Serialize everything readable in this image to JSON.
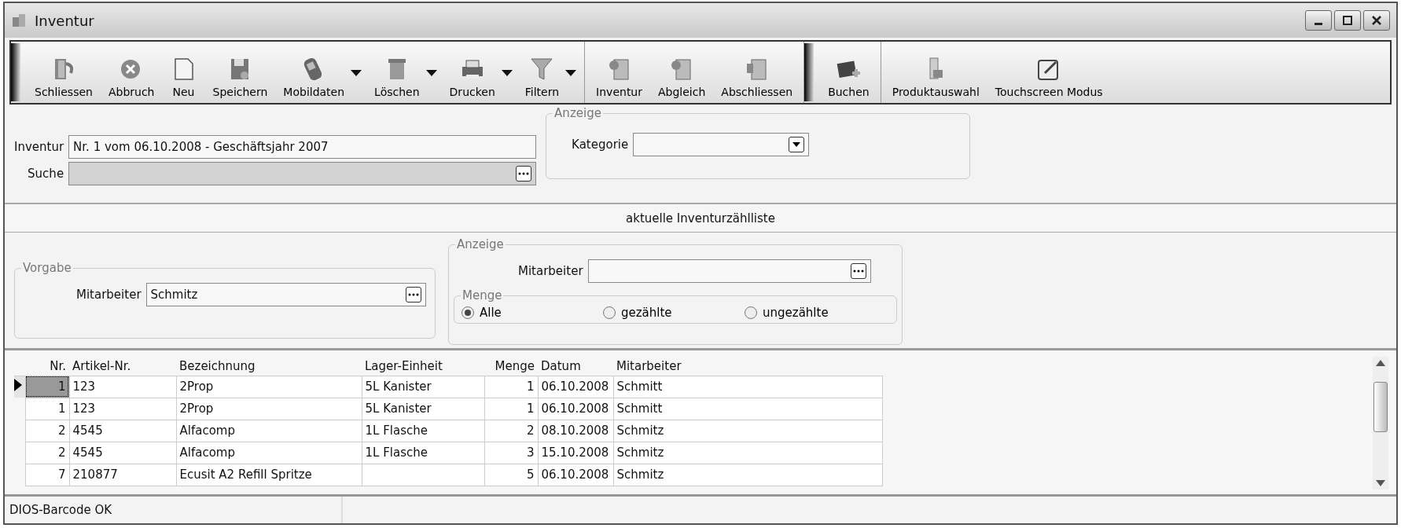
{
  "window": {
    "title": "Inventur"
  },
  "toolbar": {
    "groups": [
      [
        {
          "label": "Schliessen",
          "dropdown": false
        },
        {
          "label": "Abbruch",
          "dropdown": false
        },
        {
          "label": "Neu",
          "dropdown": false
        },
        {
          "label": "Speichern",
          "dropdown": false
        },
        {
          "label": "Mobildaten",
          "dropdown": true
        },
        {
          "label": "Löschen",
          "dropdown": true
        },
        {
          "label": "Drucken",
          "dropdown": true
        },
        {
          "label": "Filtern",
          "dropdown": true
        }
      ],
      [
        {
          "label": "Inventur",
          "dropdown": false
        },
        {
          "label": "Abgleich",
          "dropdown": false
        },
        {
          "label": "Abschliessen",
          "dropdown": false
        }
      ],
      [
        {
          "label": "Buchen",
          "dropdown": false
        }
      ],
      [
        {
          "label": "Produktauswahl",
          "dropdown": false
        },
        {
          "label": "Touchscreen Modus",
          "dropdown": false
        }
      ]
    ]
  },
  "form": {
    "inventur": {
      "label": "Inventur",
      "value": "Nr. 1 vom 06.10.2008 - Geschäftsjahr 2007"
    },
    "suche": {
      "label": "Suche",
      "disabled": true
    },
    "anzeige": {
      "title": "Anzeige",
      "kategorie_label": "Kategorie"
    }
  },
  "list_title": "aktuelle Inventurzählliste",
  "vorgabe": {
    "title": "Vorgabe",
    "mitarbeiter_label": "Mitarbeiter",
    "mitarbeiter_value": "Schmitz"
  },
  "anzeige2": {
    "title": "Anzeige",
    "mitarbeiter_label": "Mitarbeiter",
    "menge_title": "Menge",
    "options": [
      {
        "label": "Alle",
        "selected": true
      },
      {
        "label": "gezählte",
        "selected": false
      },
      {
        "label": "ungezählte",
        "selected": false
      }
    ]
  },
  "table": {
    "columns": [
      "Nr.",
      "Artikel-Nr.",
      "Bezeichnung",
      "Lager-Einheit",
      "Menge",
      "Datum",
      "Mitarbeiter"
    ],
    "rows": [
      {
        "selected": true,
        "cells": [
          "1",
          "123",
          "2Prop",
          "5L Kanister",
          "1",
          "06.10.2008",
          "Schmitt"
        ]
      },
      {
        "selected": false,
        "cells": [
          "1",
          "123",
          "2Prop",
          "5L Kanister",
          "1",
          "06.10.2008",
          "Schmitt"
        ]
      },
      {
        "selected": false,
        "cells": [
          "2",
          "4545",
          "Alfacomp",
          "1L Flasche",
          "2",
          "08.10.2008",
          "Schmitz"
        ]
      },
      {
        "selected": false,
        "cells": [
          "2",
          "4545",
          "Alfacomp",
          "1L Flasche",
          "3",
          "15.10.2008",
          "Schmitz"
        ]
      },
      {
        "selected": false,
        "cells": [
          "7",
          "210877",
          "Ecusit A2 Refill Spritze",
          "",
          "5",
          "06.10.2008",
          "Schmitz"
        ]
      }
    ]
  },
  "status_bar": {
    "text": "DIOS-Barcode OK"
  }
}
